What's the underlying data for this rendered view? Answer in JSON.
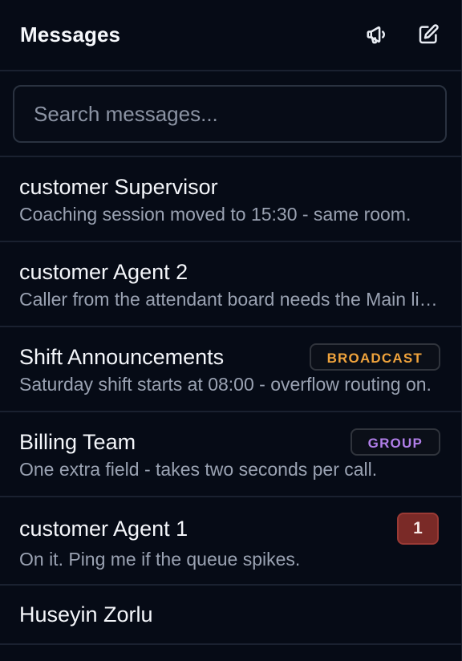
{
  "header": {
    "title": "Messages",
    "icons": [
      "megaphone-icon",
      "compose-icon"
    ]
  },
  "search": {
    "placeholder": "Search messages...",
    "value": ""
  },
  "conversations": [
    {
      "name": "customer Supervisor",
      "preview": "Coaching session moved to 15:30 - same room."
    },
    {
      "name": "customer Agent 2",
      "preview": "Caller from the attendant board needs the Main line."
    },
    {
      "name": "Shift Announcements",
      "preview": "Saturday shift starts at 08:00 - overflow routing on.",
      "tag": "BROADCAST"
    },
    {
      "name": "Billing Team",
      "preview": "One extra field - takes two seconds per call.",
      "tag": "GROUP"
    },
    {
      "name": "customer Agent 1",
      "preview": "On it. Ping me if the queue spikes.",
      "unread": "1"
    },
    {
      "name": "Huseyin Zorlu"
    }
  ],
  "colors": {
    "background": "#060b16",
    "broadcast": "#f0a33c",
    "group": "#b07ee8",
    "unread_badge": "#7a2a27"
  }
}
